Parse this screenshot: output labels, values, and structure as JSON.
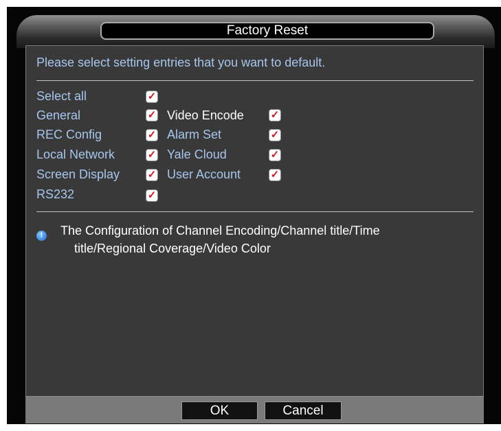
{
  "dialog": {
    "title": "Factory Reset",
    "prompt": "Please select setting entries that you want to default.",
    "info": {
      "line1": "The Configuration of Channel Encoding/Channel title/Time",
      "line2": "title/Regional Coverage/Video Color"
    },
    "buttons": {
      "ok": "OK",
      "cancel": "Cancel"
    }
  },
  "options": {
    "select_all": {
      "label": "Select all",
      "checked": true
    },
    "general": {
      "label": "General",
      "checked": true
    },
    "rec_config": {
      "label": "REC Config",
      "checked": true
    },
    "local_network": {
      "label": "Local Network",
      "checked": true
    },
    "screen_display": {
      "label": "Screen Display",
      "checked": true
    },
    "rs232": {
      "label": "RS232",
      "checked": true
    },
    "video_encode": {
      "label": "Video Encode",
      "checked": true
    },
    "alarm_set": {
      "label": "Alarm Set",
      "checked": true
    },
    "yale_cloud": {
      "label": "Yale Cloud",
      "checked": true
    },
    "user_account": {
      "label": "User Account",
      "checked": true
    }
  },
  "icons": {
    "check": "checkmark-icon",
    "info": "info-icon"
  },
  "colors": {
    "label_blue": "#a7c6ee",
    "check_red": "#d8141c",
    "panel": "#393939",
    "footer": "#7a7a7a"
  }
}
